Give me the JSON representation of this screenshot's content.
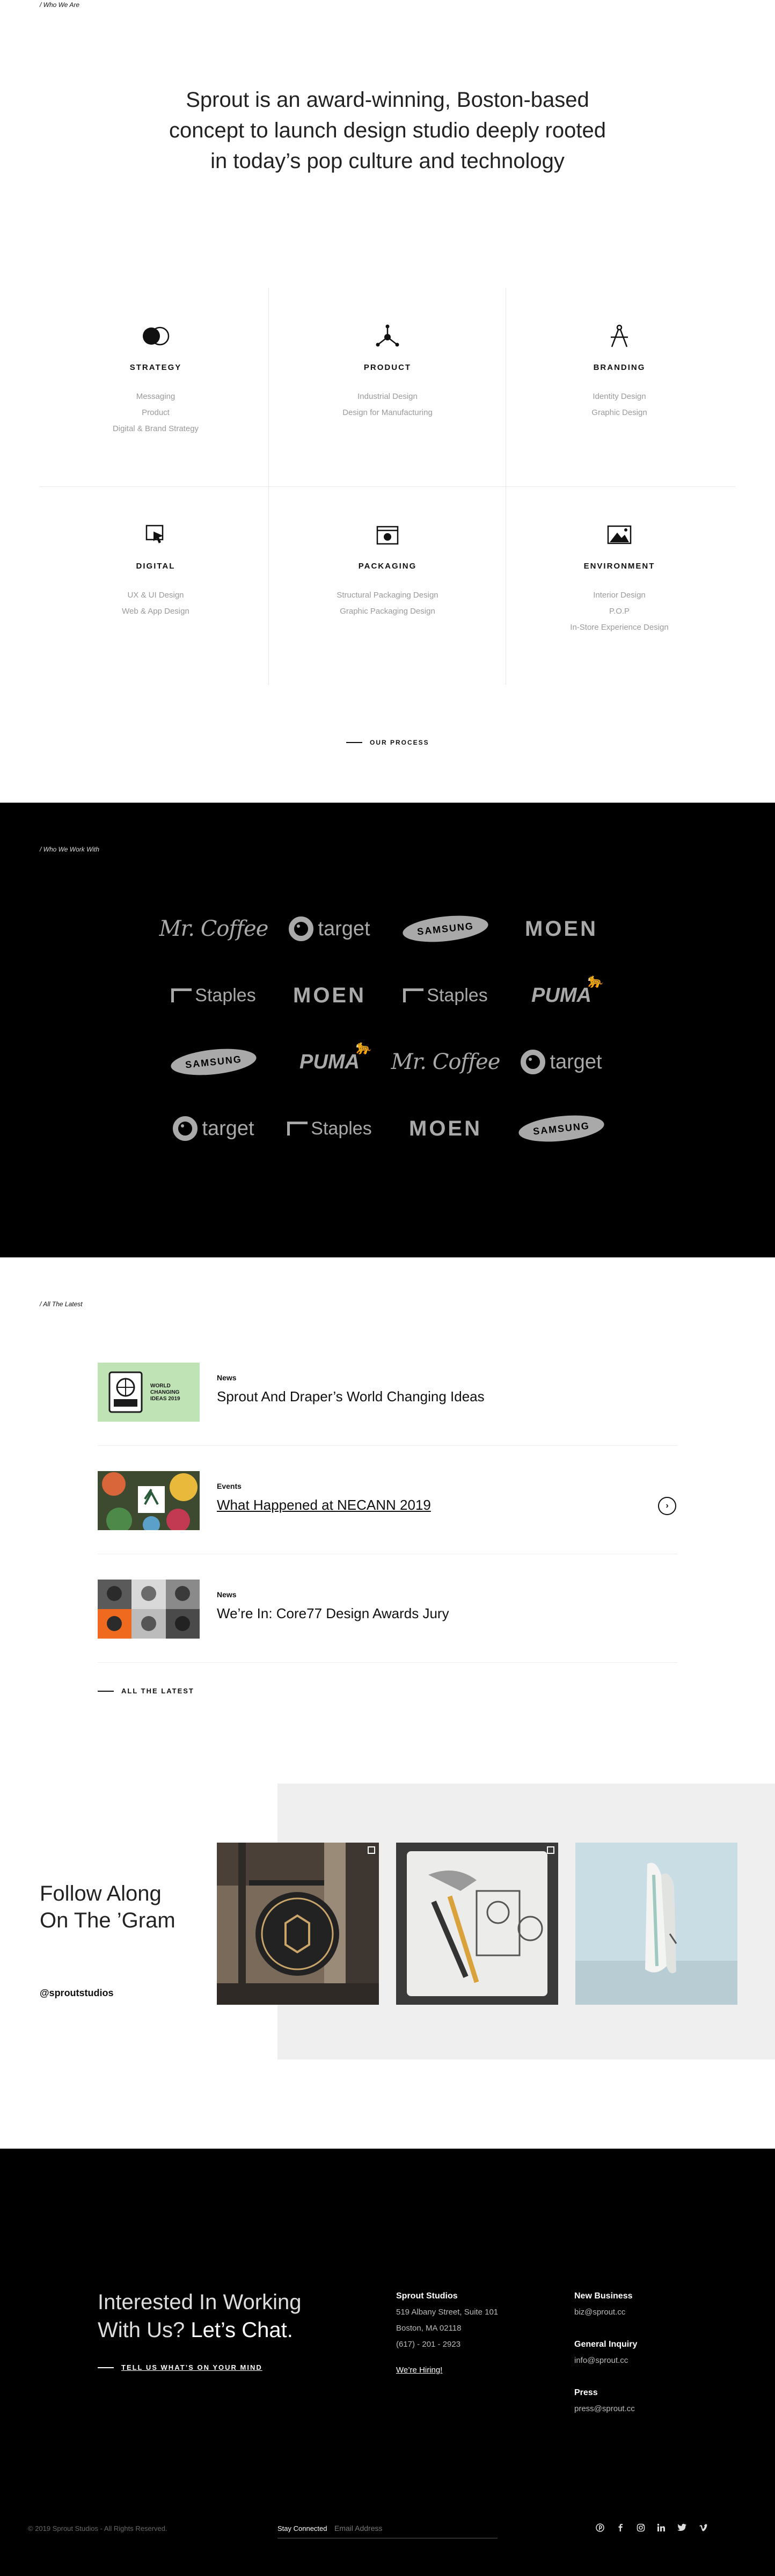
{
  "who_we_are": {
    "crumb": "/ Who We Are",
    "intro": "Sprout is an award-winning, Boston-based concept to launch design studio deeply rooted in today’s pop culture and technology",
    "services": [
      {
        "title": "STRATEGY",
        "icon": "circles-icon",
        "items": [
          "Messaging",
          "Product",
          "Digital & Brand Strategy"
        ]
      },
      {
        "title": "PRODUCT",
        "icon": "nodes-icon",
        "items": [
          "Industrial Design",
          "Design for Manufacturing"
        ]
      },
      {
        "title": "BRANDING",
        "icon": "compass-icon",
        "items": [
          "Identity Design",
          "Graphic Design"
        ]
      },
      {
        "title": "DIGITAL",
        "icon": "cursor-screen-icon",
        "items": [
          "UX & UI Design",
          "Web & App Design"
        ]
      },
      {
        "title": "PACKAGING",
        "icon": "box-icon",
        "items": [
          "Structural Packaging Design",
          "Graphic Packaging Design"
        ]
      },
      {
        "title": "ENVIRONMENT",
        "icon": "landscape-icon",
        "items": [
          "Interior Design",
          "P.O.P",
          "In-Store Experience Design"
        ]
      }
    ],
    "process_label": "OUR PROCESS"
  },
  "clients": {
    "crumb": "/ Who We Work With",
    "logos": [
      [
        "Mr. Coffee",
        "target",
        "SAMSUNG",
        "MOEN"
      ],
      [
        "Staples",
        "MOEN",
        "Staples",
        "PUMA"
      ],
      [
        "SAMSUNG",
        "PUMA",
        "Mr. Coffee",
        "target"
      ],
      [
        "target",
        "Staples",
        "MOEN",
        "SAMSUNG"
      ]
    ]
  },
  "latest": {
    "crumb": "/ All The Latest",
    "items": [
      {
        "category": "News",
        "title": "Sprout And Draper’s World Changing Ideas",
        "thumb_text": "WORLD CHANGING IDEAS 2019"
      },
      {
        "category": "Events",
        "title": "What Happened at NECANN 2019"
      },
      {
        "category": "News",
        "title": "We’re In: Core77 Design Awards Jury"
      }
    ],
    "all_label": "ALL THE LATEST"
  },
  "instagram": {
    "heading_line1": "Follow Along",
    "heading_line2": "On The ’Gram",
    "handle": "@sproutstudios"
  },
  "footer": {
    "cta_line1": "Interested In Working",
    "cta_line2a": "With Us?",
    "cta_line2b": "Let’s Chat.",
    "tell_label": "TELL US WHAT’S ON YOUR MIND",
    "studio": {
      "heading": "Sprout Studios",
      "address1": "519 Albany Street, Suite 101",
      "address2": "Boston, MA 02118",
      "phone": "(617) - 201 - 2923",
      "hiring": "We’re Hiring!"
    },
    "contacts": {
      "new_business_heading": "New Business",
      "new_business_email": "biz@sprout.cc",
      "general_heading": "General Inquiry",
      "general_email": "info@sprout.cc",
      "press_heading": "Press",
      "press_email": "press@sprout.cc"
    },
    "copyright": "© 2019 Sprout Studios - All Rights Reserved.",
    "stay_label": "Stay Connected",
    "email_placeholder": "Email Address",
    "social": [
      "pinterest-icon",
      "facebook-icon",
      "instagram-icon",
      "linkedin-icon",
      "twitter-icon",
      "vimeo-icon"
    ]
  }
}
